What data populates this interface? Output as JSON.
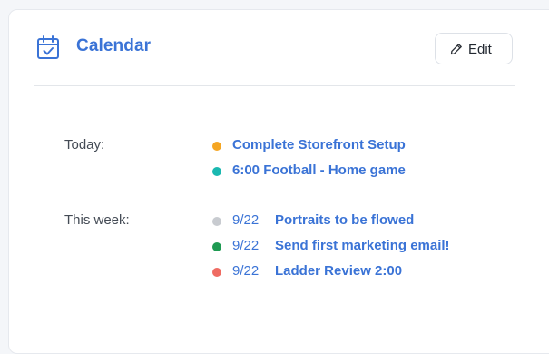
{
  "header": {
    "title": "Calendar",
    "edit_label": "Edit"
  },
  "sections": {
    "today": {
      "label": "Today:",
      "events": [
        {
          "text": "Complete Storefront Setup",
          "dot_color": "#f5a623"
        },
        {
          "text": "6:00 Football - Home game",
          "dot_color": "#1ab8b0"
        }
      ]
    },
    "week": {
      "label": "This week:",
      "events": [
        {
          "date": "9/22",
          "text": "Portraits to be flowed",
          "dot_color": "#c8cbd0"
        },
        {
          "date": "9/22",
          "text": "Send first marketing email!",
          "dot_color": "#1e9a52"
        },
        {
          "date": "9/22",
          "text": "Ladder Review 2:00",
          "dot_color": "#ef6b62"
        }
      ]
    }
  },
  "colors": {
    "accent": "#3a73d6"
  },
  "icons": {
    "header": "calendar-check-icon",
    "edit": "pencil-icon"
  }
}
